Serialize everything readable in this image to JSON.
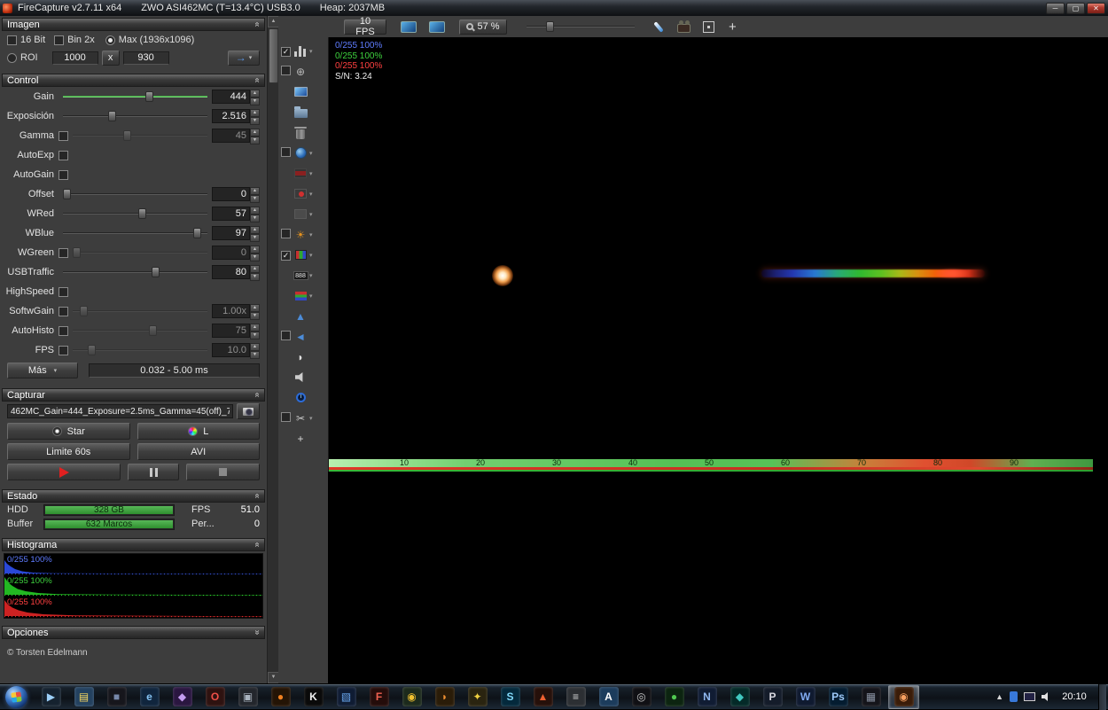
{
  "titlebar": {
    "app_title": "FireCapture v2.7.11 x64",
    "camera_info": "ZWO ASI462MC (T=13.4°C) USB3.0",
    "heap": "Heap: 2037MB"
  },
  "panels": {
    "imagen": {
      "title": "Imagen",
      "bit16_label": "16 Bit",
      "bin2x_label": "Bin 2x",
      "max_label": "Max (1936x1096)",
      "roi_label": "ROI",
      "roi_width": "1000",
      "roi_x_label": "x",
      "roi_height": "930"
    },
    "control": {
      "title": "Control",
      "rows": [
        {
          "label": "Gain",
          "value": "444",
          "slider": {
            "pct": 60,
            "green": true
          }
        },
        {
          "label": "Exposición",
          "value": "2.516",
          "slider": {
            "pct": 33
          }
        },
        {
          "label": "Gamma",
          "value": "45",
          "cb": false,
          "dim": true,
          "slider": {
            "pct": 40,
            "disabled": true
          }
        },
        {
          "label": "AutoExp",
          "cb": false
        },
        {
          "label": "AutoGain",
          "cb": false
        },
        {
          "label": "Offset",
          "value": "0",
          "slider": {
            "pct": 0
          }
        },
        {
          "label": "WRed",
          "value": "57",
          "slider": {
            "pct": 55
          }
        },
        {
          "label": "WBlue",
          "value": "97",
          "slider": {
            "pct": 96
          }
        },
        {
          "label": "WGreen",
          "value": "0",
          "cb": false,
          "dim": true,
          "slider": {
            "pct": 0,
            "disabled": true
          }
        },
        {
          "label": "USBTraffic",
          "value": "80",
          "slider": {
            "pct": 65
          }
        },
        {
          "label": "HighSpeed",
          "cb": false
        },
        {
          "label": "SoftwGain",
          "value": "1.00x",
          "cb": false,
          "dim": true,
          "slider": {
            "pct": 5,
            "disabled": true
          }
        },
        {
          "label": "AutoHisto",
          "value": "75",
          "cb": false,
          "dim": true,
          "slider": {
            "pct": 60,
            "disabled": true
          }
        },
        {
          "label": "FPS",
          "value": "10.0",
          "cb": false,
          "dim": true,
          "slider": {
            "pct": 12,
            "disabled": true
          }
        }
      ],
      "mas_label": "Más",
      "exposure_range": "0.032 - 5.00 ms"
    },
    "capturar": {
      "title": "Capturar",
      "filename": "462MC_Gain=444_Exposure=2.5ms_Gamma=45(off)_7",
      "star_label": "Star",
      "l_label": "L",
      "limit_label": "Limite 60s",
      "format_label": "AVI"
    },
    "estado": {
      "title": "Estado",
      "hdd_label": "HDD",
      "hdd_value": "328 GB",
      "fps_label": "FPS",
      "fps_value": "51.0",
      "buffer_label": "Buffer",
      "buffer_value": "632 Marcos",
      "per_label": "Per...",
      "per_value": "0"
    },
    "histograma": {
      "title": "Histograma",
      "blue_stat": "0/255 100%",
      "green_stat": "0/255 100%",
      "red_stat": "0/255 100%"
    },
    "opciones": {
      "title": "Opciones"
    },
    "copyright": "© Torsten Edelmann"
  },
  "toolbar": {
    "fps_button": "10 FPS",
    "zoom_value": "57 %",
    "add_button": "+"
  },
  "image_overlay": {
    "blue_stat": "0/255 100%",
    "green_stat": "0/255 100%",
    "red_stat": "0/255 100%",
    "snr": "S/N: 3.24",
    "ruler_ticks": [
      "10",
      "20",
      "30",
      "40",
      "50",
      "60",
      "70",
      "80",
      "90"
    ]
  },
  "side_toolbar": {
    "icons": [
      {
        "name": "histogram-panel-icon",
        "cb": "checked",
        "kind": "bars",
        "arrow": true
      },
      {
        "name": "reticle-icon",
        "cb": "unchecked",
        "kind": "glyph",
        "glyph": "⊕",
        "color": "#b8b8b8"
      },
      {
        "name": "screenshot-icon",
        "kind": "screen"
      },
      {
        "name": "folder-icon",
        "kind": "folder"
      },
      {
        "name": "trash-icon",
        "kind": "trash"
      },
      {
        "name": "web-upload-icon",
        "cb": "unchecked",
        "kind": "globe",
        "arrow": true
      },
      {
        "name": "film-icon",
        "kind": "film",
        "arrow": true
      },
      {
        "name": "rec-settings-icon",
        "kind": "reddot",
        "arrow": true
      },
      {
        "name": "disabled-tool-icon",
        "kind": "grayicon",
        "arrow": true
      },
      {
        "name": "sun-marker-icon",
        "cb": "unchecked",
        "kind": "glyph",
        "glyph": "☀",
        "color": "#e09020",
        "arrow": true
      },
      {
        "name": "color-grid-icon",
        "cb": "checked",
        "kind": "rgbgrid",
        "arrow": true
      },
      {
        "name": "digits-overlay-icon",
        "kind": "digits",
        "text": "888",
        "arrow": true
      },
      {
        "name": "color-bars-icon",
        "kind": "stripes",
        "arrow": true
      },
      {
        "name": "peak-indicator-icon",
        "kind": "glyph",
        "glyph": "▲",
        "color": "#4c8cd8"
      },
      {
        "name": "flip-icon",
        "cb": "unchecked",
        "kind": "glyph",
        "glyph": "◄",
        "color": "#4c8cd8"
      },
      {
        "name": "contrast-icon",
        "kind": "glyph",
        "glyph": "◗",
        "color": "#e0e0e0"
      },
      {
        "name": "speaker-icon",
        "kind": "speaker"
      },
      {
        "name": "timer-icon",
        "kind": "clock"
      },
      {
        "name": "cut-icon",
        "cb": "unchecked",
        "kind": "glyph",
        "glyph": "✂",
        "color": "#c8c8c8",
        "arrow": true
      },
      {
        "name": "add-tool-icon",
        "kind": "glyph",
        "glyph": "+",
        "color": "#d8d8d8"
      }
    ]
  },
  "taskbar": {
    "clock": "20:10",
    "icons": [
      {
        "name": "taskbar-media-player",
        "glyph": "▶",
        "fg": "#9ccff8",
        "bg": "#15222f"
      },
      {
        "name": "taskbar-explorer",
        "glyph": "▤",
        "fg": "#f8d860",
        "bg": "#23415f"
      },
      {
        "name": "taskbar-app-dark",
        "glyph": "■",
        "fg": "#7788aa",
        "bg": "#16161c"
      },
      {
        "name": "taskbar-ie",
        "glyph": "e",
        "fg": "#86c4f4",
        "bg": "#10253d"
      },
      {
        "name": "taskbar-app-violet",
        "glyph": "◆",
        "fg": "#c49cf0",
        "bg": "#2a1640"
      },
      {
        "name": "taskbar-opera",
        "glyph": "O",
        "fg": "#f05048",
        "bg": "#2e1210"
      },
      {
        "name": "taskbar-app-gray",
        "glyph": "▣",
        "fg": "#aab4c0",
        "bg": "#23262c"
      },
      {
        "name": "taskbar-app-orange",
        "glyph": "●",
        "fg": "#f08020",
        "bg": "#241405"
      },
      {
        "name": "taskbar-k-app",
        "glyph": "K",
        "fg": "#f0f0f0",
        "bg": "#0a0a0a"
      },
      {
        "name": "taskbar-app-blue",
        "glyph": "▧",
        "fg": "#6aa8f0",
        "bg": "#0f1c33"
      },
      {
        "name": "taskbar-firecapture",
        "glyph": "F",
        "fg": "#f06050",
        "bg": "#240c0a"
      },
      {
        "name": "taskbar-chrome",
        "glyph": "◉",
        "fg": "#f0c030",
        "bg": "#1c2a1c"
      },
      {
        "name": "taskbar-firefox",
        "glyph": "◗",
        "fg": "#f09030",
        "bg": "#2a1c08"
      },
      {
        "name": "taskbar-app-yellow",
        "glyph": "✦",
        "fg": "#f0d040",
        "bg": "#2a2410"
      },
      {
        "name": "taskbar-skype",
        "glyph": "S",
        "fg": "#80d8f8",
        "bg": "#04293c"
      },
      {
        "name": "taskbar-flame-app",
        "glyph": "▲",
        "fg": "#f06030",
        "bg": "#26100a"
      },
      {
        "name": "taskbar-notes",
        "glyph": "≡",
        "fg": "#d8d8d8",
        "bg": "#2c2f33"
      },
      {
        "name": "taskbar-asi-app",
        "glyph": "A",
        "fg": "#ffffff",
        "bg": "#1c3c5c"
      },
      {
        "name": "taskbar-camera-app",
        "glyph": "◎",
        "fg": "#c8c8c8",
        "bg": "#101014"
      },
      {
        "name": "taskbar-app-green",
        "glyph": "●",
        "fg": "#50c850",
        "bg": "#0c2410"
      },
      {
        "name": "taskbar-app-n",
        "glyph": "N",
        "fg": "#90b8f0",
        "bg": "#101c33"
      },
      {
        "name": "taskbar-app-teal",
        "glyph": "◆",
        "fg": "#40c8c0",
        "bg": "#042a28"
      },
      {
        "name": "taskbar-phd-app",
        "glyph": "P",
        "fg": "#d8d8e0",
        "bg": "#141c2a"
      },
      {
        "name": "taskbar-word",
        "glyph": "W",
        "fg": "#80aaf0",
        "bg": "#0f1a30"
      },
      {
        "name": "taskbar-ps-app",
        "glyph": "Ps",
        "fg": "#9cc8f8",
        "bg": "#041c30"
      },
      {
        "name": "taskbar-app-dark2",
        "glyph": "▦",
        "fg": "#8890a0",
        "bg": "#14141a"
      },
      {
        "name": "taskbar-capture-active",
        "glyph": "◉",
        "fg": "#f8a060",
        "bg": "#3a1c08",
        "active": true
      }
    ]
  }
}
